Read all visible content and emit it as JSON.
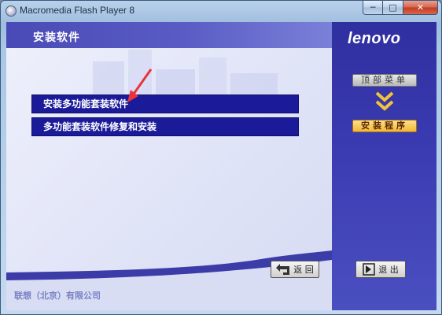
{
  "window": {
    "title": "Macromedia Flash Player 8",
    "minimize_label": "─",
    "maximize_label": "□",
    "close_label": "✕"
  },
  "main": {
    "title": "安装软件",
    "options": [
      {
        "label": "安装多功能套装软件"
      },
      {
        "label": "多功能套装软件修复和安装"
      }
    ],
    "back_label": "返 回",
    "company": "联想（北京）有限公司"
  },
  "side": {
    "logo": "lenovo",
    "top_menu_label": "顶部菜单",
    "install_label": "安装程序",
    "exit_label": "退 出"
  },
  "colors": {
    "header_band": "#4a4ab6",
    "option_bg": "#1b1b9a",
    "side_bg": "#3a3ab0",
    "install_highlight": "#f0b73a",
    "arrow": "#e8343a"
  },
  "icons": [
    "app-icon",
    "back-arrow-icon",
    "exit-icon",
    "chevron-down-icon"
  ]
}
